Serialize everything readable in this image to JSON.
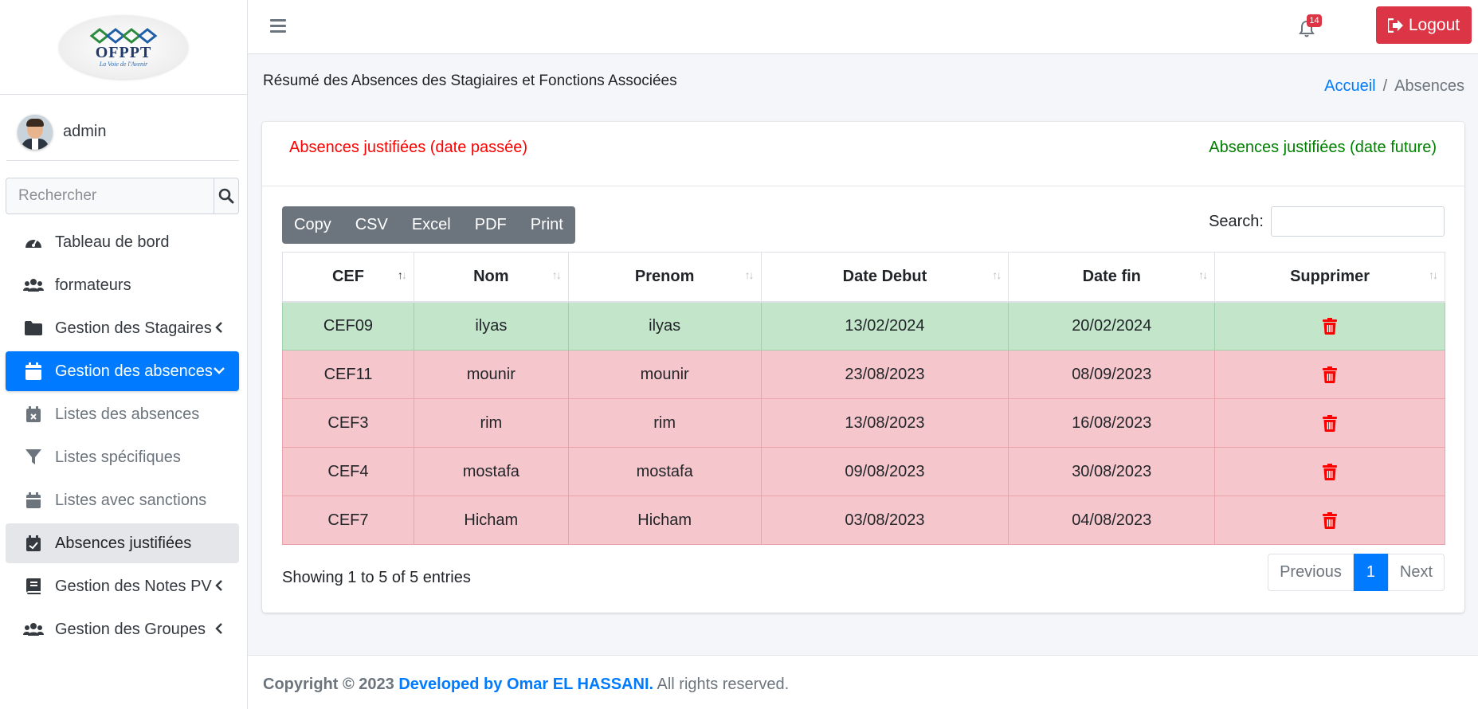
{
  "brand": {
    "logo_text": "OFPPT",
    "logo_sub": "La Voie de l'Avenir"
  },
  "user": {
    "name": "admin"
  },
  "sidebar_search": {
    "placeholder": "Rechercher"
  },
  "nav": {
    "items": [
      {
        "label": "Tableau de bord",
        "icon": "tachometer-icon"
      },
      {
        "label": "formateurs",
        "icon": "users-icon"
      },
      {
        "label": "Gestion des Stagaires",
        "icon": "folder-icon"
      },
      {
        "label": "Gestion des absences",
        "icon": "calendar-icon"
      },
      {
        "label": "Listes des absences",
        "icon": "calendar-x-icon"
      },
      {
        "label": "Listes spécifiques",
        "icon": "filter-icon"
      },
      {
        "label": "Listes avec sanctions",
        "icon": "calendar-icon"
      },
      {
        "label": "Absences justifiées",
        "icon": "calendar-check-icon"
      },
      {
        "label": "Gestion des Notes PV",
        "icon": "book-icon"
      },
      {
        "label": "Gestion des Groupes",
        "icon": "users-icon"
      }
    ]
  },
  "topbar": {
    "notifications_count": "14",
    "logout_label": "Logout"
  },
  "page": {
    "title": "Résumé des Absences des Stagiaires et Fonctions Associées"
  },
  "breadcrumb": {
    "home": "Accueil",
    "separator": "/",
    "current": "Absences"
  },
  "legend": {
    "past": "Absences justifiées (date passée)",
    "future": "Absences justifiées (date future)",
    "past_color": "#ff0000",
    "future_color": "#008000"
  },
  "export_buttons": [
    "Copy",
    "CSV",
    "Excel",
    "PDF",
    "Print"
  ],
  "table_search": {
    "label": "Search:"
  },
  "table": {
    "headers": [
      "CEF",
      "Nom",
      "Prenom",
      "Date Debut",
      "Date fin",
      "Supprimer"
    ],
    "rows": [
      {
        "cef": "CEF09",
        "nom": "ilyas",
        "prenom": "ilyas",
        "date_debut": "13/02/2024",
        "date_fin": "20/02/2024",
        "status": "future"
      },
      {
        "cef": "CEF11",
        "nom": "mounir",
        "prenom": "mounir",
        "date_debut": "23/08/2023",
        "date_fin": "08/09/2023",
        "status": "past"
      },
      {
        "cef": "CEF3",
        "nom": "rim",
        "prenom": "rim",
        "date_debut": "13/08/2023",
        "date_fin": "16/08/2023",
        "status": "past"
      },
      {
        "cef": "CEF4",
        "nom": "mostafa",
        "prenom": "mostafa",
        "date_debut": "09/08/2023",
        "date_fin": "30/08/2023",
        "status": "past"
      },
      {
        "cef": "CEF7",
        "nom": "Hicham",
        "prenom": "Hicham",
        "date_debut": "03/08/2023",
        "date_fin": "04/08/2023",
        "status": "past"
      }
    ],
    "row_colors": {
      "future": "#c3e6cb",
      "past": "#f5c6cb"
    }
  },
  "table_info": "Showing 1 to 5 of 5 entries",
  "pagination": {
    "previous": "Previous",
    "current": "1",
    "next": "Next"
  },
  "footer": {
    "copyright": "Copyright © 2023",
    "developer": "Developed by Omar EL HASSANI.",
    "rights": "All rights reserved."
  },
  "colors": {
    "primary": "#007bff",
    "danger": "#dc3545",
    "secondary": "#6c757d"
  }
}
